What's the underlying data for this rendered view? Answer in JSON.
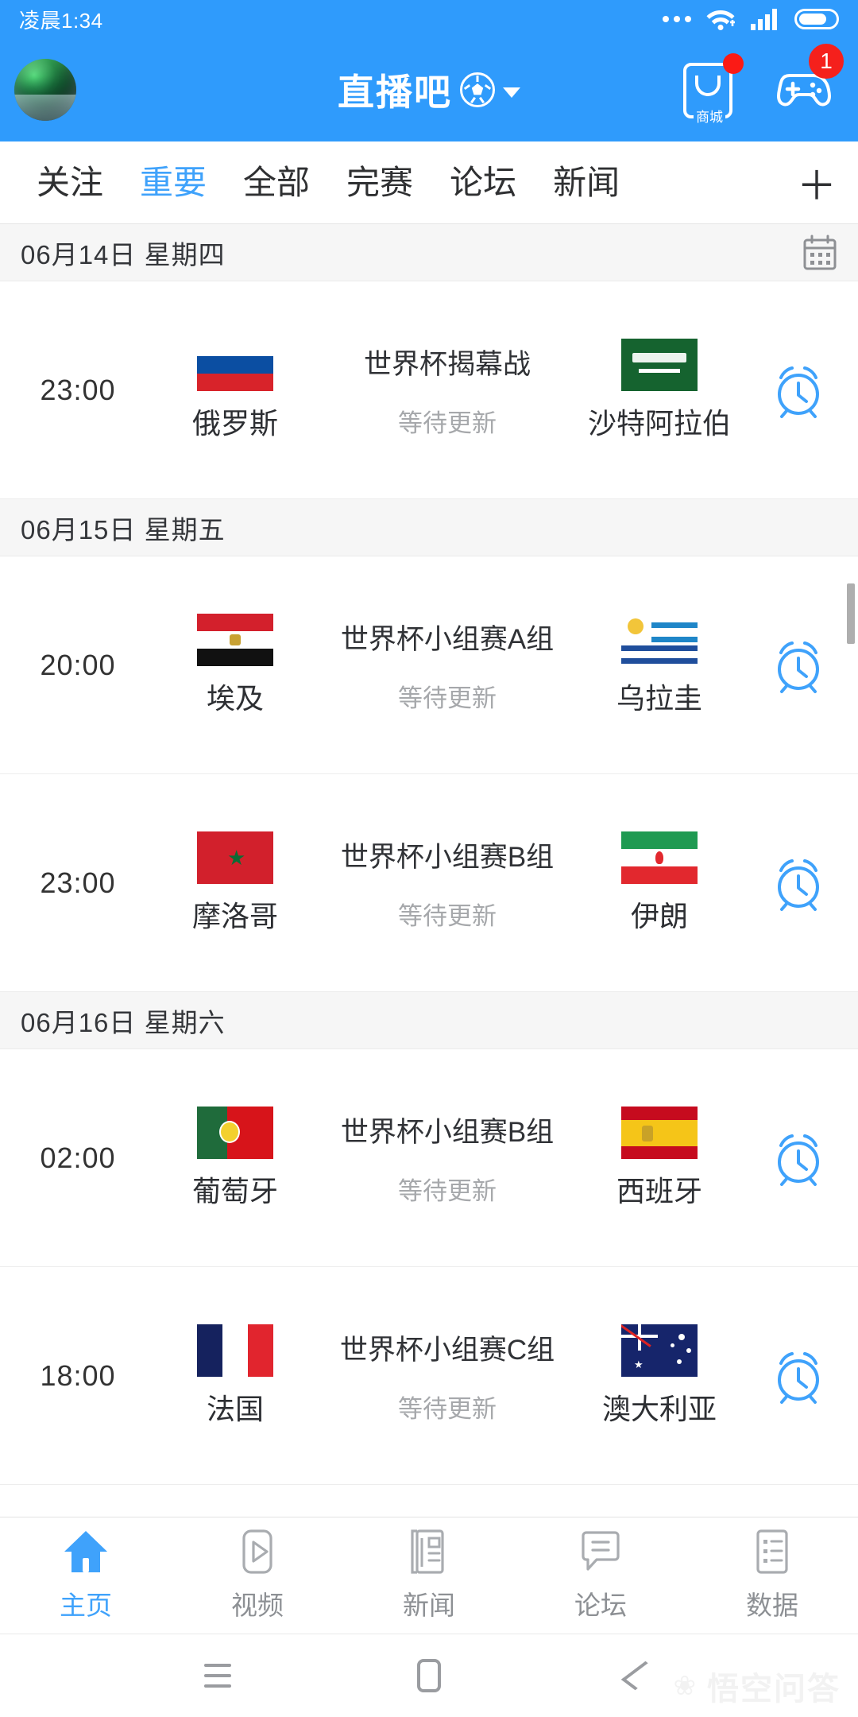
{
  "status_bar": {
    "time": "凌晨1:34",
    "icons": [
      "more-dots-icon",
      "wifi-icon",
      "signal-icon",
      "battery-icon"
    ]
  },
  "header": {
    "avatar_name": "user-avatar",
    "title": "直播吧",
    "title_icon": "soccer-ball-icon",
    "dropdown_icon": "chevron-down-icon",
    "shop": {
      "icon": "shopping-bag-icon",
      "label": "商城",
      "badge": ""
    },
    "game": {
      "icon": "gamepad-icon",
      "badge": "1"
    },
    "accent_color": "#2f9bfc",
    "badge_color": "#f5201c"
  },
  "tabs": {
    "items": [
      {
        "label": "关注",
        "active": false
      },
      {
        "label": "重要",
        "active": true
      },
      {
        "label": "全部",
        "active": false
      },
      {
        "label": "完赛",
        "active": false
      },
      {
        "label": "论坛",
        "active": false
      },
      {
        "label": "新闻",
        "active": false
      }
    ],
    "add_label": "＋",
    "active_color": "#3fa2fb"
  },
  "sections": [
    {
      "date": "06月14日 星期四",
      "calendar_icon": "calendar-icon",
      "matches": [
        {
          "time": "23:00",
          "home": "俄罗斯",
          "home_flag": "russia-flag",
          "away": "沙特阿拉伯",
          "away_flag": "saudi-arabia-flag",
          "league": "世界杯揭幕战",
          "status": "等待更新",
          "alarm_icon": "alarm-clock-icon"
        }
      ]
    },
    {
      "date": "06月15日 星期五",
      "calendar_icon": "",
      "matches": [
        {
          "time": "20:00",
          "home": "埃及",
          "home_flag": "egypt-flag",
          "away": "乌拉圭",
          "away_flag": "uruguay-flag",
          "league": "世界杯小组赛A组",
          "status": "等待更新",
          "alarm_icon": "alarm-clock-icon"
        },
        {
          "time": "23:00",
          "home": "摩洛哥",
          "home_flag": "morocco-flag",
          "away": "伊朗",
          "away_flag": "iran-flag",
          "league": "世界杯小组赛B组",
          "status": "等待更新",
          "alarm_icon": "alarm-clock-icon"
        }
      ]
    },
    {
      "date": "06月16日 星期六",
      "calendar_icon": "",
      "matches": [
        {
          "time": "02:00",
          "home": "葡萄牙",
          "home_flag": "portugal-flag",
          "away": "西班牙",
          "away_flag": "spain-flag",
          "league": "世界杯小组赛B组",
          "status": "等待更新",
          "alarm_icon": "alarm-clock-icon"
        },
        {
          "time": "18:00",
          "home": "法国",
          "home_flag": "france-flag",
          "away": "澳大利亚",
          "away_flag": "australia-flag",
          "league": "世界杯小组赛C组",
          "status": "等待更新",
          "alarm_icon": "alarm-clock-icon"
        }
      ]
    }
  ],
  "bottom_nav": {
    "items": [
      {
        "label": "主页",
        "icon": "home-icon",
        "active": true
      },
      {
        "label": "视频",
        "icon": "play-icon",
        "active": false
      },
      {
        "label": "新闻",
        "icon": "newspaper-icon",
        "active": false
      },
      {
        "label": "论坛",
        "icon": "chat-bubble-icon",
        "active": false
      },
      {
        "label": "数据",
        "icon": "list-icon",
        "active": false
      }
    ],
    "active_color": "#3fa2fb"
  },
  "android_nav": {
    "menu_icon": "menu-icon",
    "home_icon": "home-square-icon",
    "back_icon": "back-chevron-icon"
  },
  "watermark": {
    "text": "悟空问答"
  }
}
